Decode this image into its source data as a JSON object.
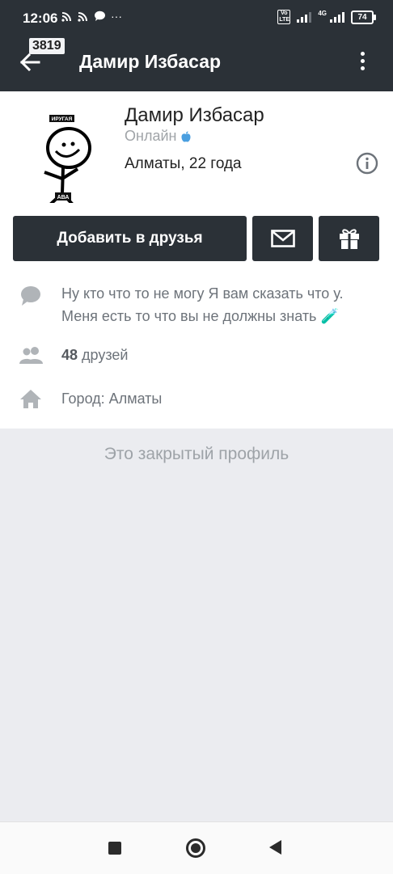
{
  "status_bar": {
    "time": "12:06",
    "left_icons": [
      "cast-icon",
      "cast-icon",
      "chat-bubble-icon",
      "more-dots-icon"
    ],
    "volte": "Vo LTE",
    "network": "4G",
    "battery": "74"
  },
  "header": {
    "counter": "3819",
    "title": "Дамир Избасар"
  },
  "profile": {
    "avatar_top_text": "ИРУГАЯ",
    "avatar_bottom_text": "АВА",
    "name": "Дамир Избасар",
    "online": "Онлайн",
    "location": "Алматы, 22 года"
  },
  "actions": {
    "add_friend": "Добавить в друзья"
  },
  "details": {
    "status_line1": "Ну кто что то не могу Я вам сказать что у.",
    "status_line2": "Меня есть то что вы не должны знать 🧪",
    "friends_count": "48",
    "friends_label": " друзей",
    "city": "Город: Алматы"
  },
  "private_notice": "Это закрытый профиль",
  "colors": {
    "dark": "#2b3137",
    "background": "#ebecf0",
    "muted_text": "#6d737a",
    "apple_blue": "#4a9fe0"
  }
}
